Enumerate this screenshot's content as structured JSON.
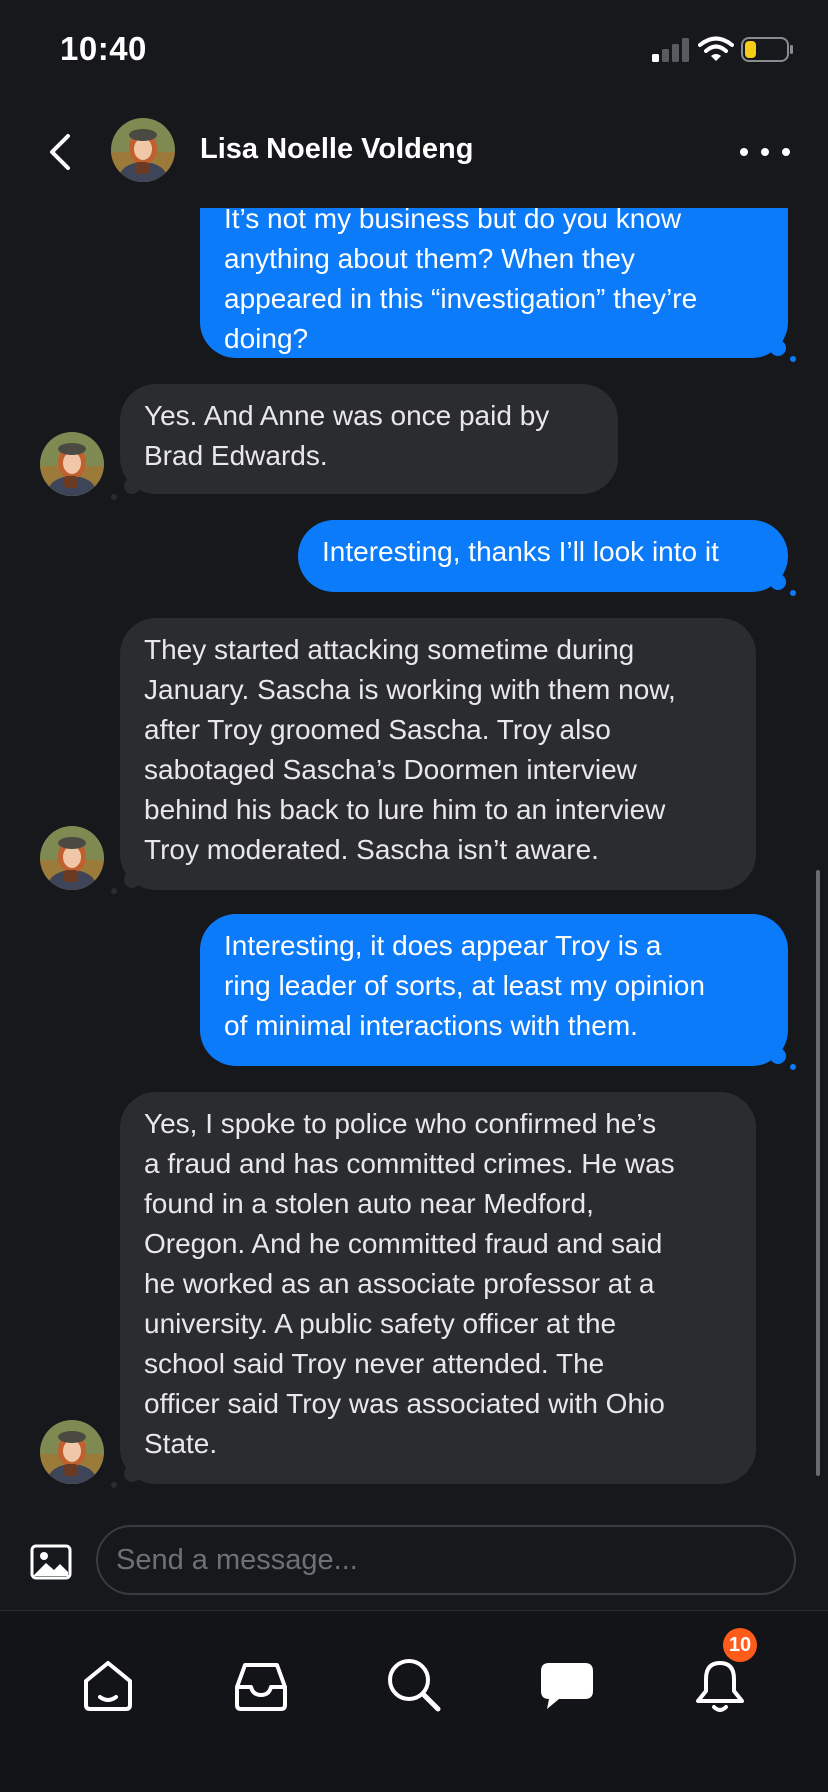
{
  "status_bar": {
    "time": "10:40",
    "icons": [
      "cellular-signal-icon",
      "wifi-icon",
      "battery-low-icon"
    ]
  },
  "header": {
    "contact_name": "Lisa Noelle Voldeng",
    "icons": [
      "back-chevron-icon",
      "more-dots-icon"
    ]
  },
  "messages": [
    {
      "direction": "out",
      "lines": [
        "It’s not my business but do you know",
        "anything about them? When they",
        "appeared in this “investigation” they’re",
        "doing?"
      ]
    },
    {
      "direction": "in",
      "lines": [
        "Yes. And Anne was once paid by",
        "Brad Edwards."
      ]
    },
    {
      "direction": "out",
      "lines": [
        "Interesting, thanks I’ll look into it"
      ]
    },
    {
      "direction": "in",
      "lines": [
        "They started attacking sometime during",
        "January. Sascha is working with them now,",
        "after Troy groomed Sascha. Troy also",
        "sabotaged Sascha’s Doormen interview",
        "behind his back to lure him to an interview",
        "Troy moderated. Sascha isn’t aware."
      ]
    },
    {
      "direction": "out",
      "lines": [
        "Interesting, it does appear Troy is a",
        "ring leader of sorts, at least my opinion",
        "of minimal interactions with them."
      ]
    },
    {
      "direction": "in",
      "lines": [
        "Yes, I spoke to police who confirmed he’s",
        "a fraud and has committed crimes. He was",
        "found in a stolen auto near Medford,",
        "Oregon. And he committed fraud and said",
        "he worked as an associate professor at a",
        "university. A public safety officer at the",
        "school said Troy never attended. The",
        "officer said Troy was associated with Ohio",
        "State."
      ]
    }
  ],
  "composer": {
    "placeholder": "Send a message...",
    "image_icon": "image-attach-icon"
  },
  "tab_bar": {
    "tabs": [
      "home-icon",
      "inbox-icon",
      "search-icon",
      "chat-icon",
      "bell-icon"
    ],
    "notification_count": "10"
  },
  "colors": {
    "background": "#17181c",
    "outgoing_bubble": "#0b7bfa",
    "incoming_bubble": "#2b2c30",
    "badge": "#ff5b1a"
  }
}
